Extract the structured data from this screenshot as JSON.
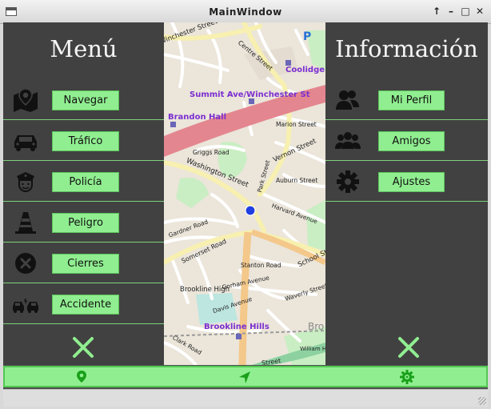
{
  "window": {
    "title": "MainWindow",
    "controls": {
      "keep_above": "↑",
      "minimize": "–",
      "maximize": "□",
      "close": "✕"
    }
  },
  "left_panel": {
    "title": "Menú",
    "items": [
      {
        "label": "Navegar",
        "icon": "map-pin-icon"
      },
      {
        "label": "Tráfico",
        "icon": "car-icon"
      },
      {
        "label": "Policía",
        "icon": "police-officer-icon"
      },
      {
        "label": "Peligro",
        "icon": "traffic-cone-icon"
      },
      {
        "label": "Cierres",
        "icon": "close-circle-icon"
      },
      {
        "label": "Accidente",
        "icon": "car-crash-icon"
      }
    ],
    "close_icon": "close-x-icon"
  },
  "right_panel": {
    "title": "Información",
    "items": [
      {
        "label": "Mi Perfil",
        "icon": "users-pair-icon"
      },
      {
        "label": "Amigos",
        "icon": "group-icon"
      },
      {
        "label": "Ajustes",
        "icon": "gear-icon"
      }
    ],
    "close_icon": "close-x-icon"
  },
  "map": {
    "labels": {
      "winchester_top": "Winchester Street",
      "centre_street": "Centre Street",
      "coolidge": "Coolidge",
      "summit": "Summit Ave/Winchester St",
      "brandon_hall": "Brandon Hall",
      "marion_street": "Marion Street",
      "vernon_street": "Vernon Street",
      "griggs_road": "Griggs Road",
      "washington_street": "Washington Street",
      "park_street": "Park Street",
      "auburn_street": "Auburn Street",
      "harvard_avenue": "Harvard Avenue",
      "gardner_road": "Gardner Road",
      "somerset_road": "Somerset Road",
      "school_street": "School Street",
      "stanton_road": "Stanton Road",
      "gorham_avenue": "Gorham Avenue",
      "waverly_street": "Waverly Street",
      "brookline_high": "Brookline High",
      "davis_avenue": "Davis Avenue",
      "brookline_hills": "Brookline Hills",
      "clark_road": "Clark Road",
      "william_h_lincoln": "William H Lincoln",
      "brookline_cut": "Bro",
      "parking": "P",
      "lower_street": "Street"
    },
    "location_marker_color": "#1f3fe0"
  },
  "toolbar": {
    "items": [
      {
        "icon": "location-pin-icon"
      },
      {
        "icon": "navigate-arrow-icon"
      },
      {
        "icon": "target-settings-icon"
      }
    ]
  },
  "colors": {
    "accent_green": "#90ee90",
    "panel_bg": "#414141",
    "divider": "#7fd17f"
  }
}
